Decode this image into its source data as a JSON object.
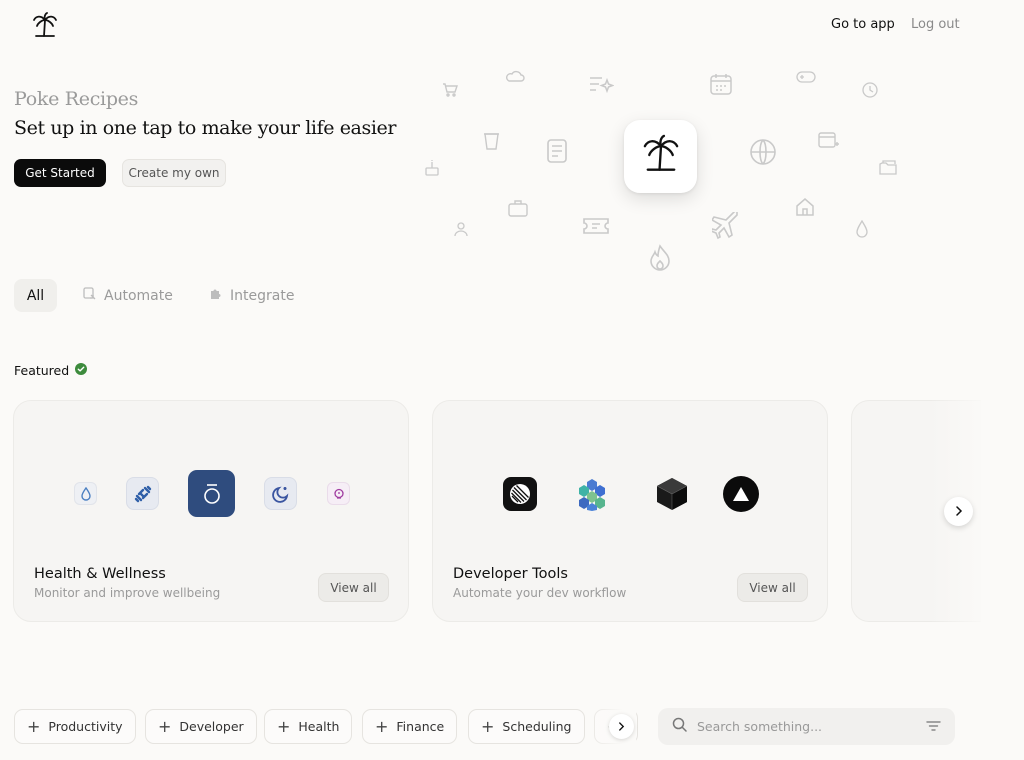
{
  "header": {
    "logo_icon": "palm-tree-icon",
    "go_to_app": "Go to app",
    "log_out": "Log out"
  },
  "hero": {
    "subtitle": "Poke Recipes",
    "title": "Set up in one tap to make your life easier",
    "get_started": "Get Started",
    "create_own": "Create my own"
  },
  "tabs": [
    {
      "label": "All",
      "icon": ""
    },
    {
      "label": "Automate",
      "icon": "automate-icon"
    },
    {
      "label": "Integrate",
      "icon": "puzzle-icon"
    }
  ],
  "featured": {
    "label": "Featured",
    "badge_icon": "verified-badge-icon",
    "badge_color": "#3d8b3d",
    "cards": [
      {
        "title": "Health & Wellness",
        "description": "Monitor and improve wellbeing",
        "view_all": "View all",
        "apps": [
          "water-drop-icon",
          "dumbbell-icon",
          "oura-ring-icon",
          "sleep-moon-icon",
          "brain-icon"
        ]
      },
      {
        "title": "Developer Tools",
        "description": "Automate your dev workflow",
        "view_all": "View all",
        "apps": [
          "linear-icon",
          "hexagon-cluster-icon",
          "cube-icon",
          "vercel-triangle-icon"
        ]
      }
    ]
  },
  "categories": [
    {
      "label": "Productivity"
    },
    {
      "label": "Developer"
    },
    {
      "label": "Health"
    },
    {
      "label": "Finance"
    },
    {
      "label": "Scheduling"
    }
  ],
  "search": {
    "placeholder": "Search something..."
  },
  "colors": {
    "primary_button": "#0b0b0b",
    "health_tile": "#2f4c7e"
  }
}
